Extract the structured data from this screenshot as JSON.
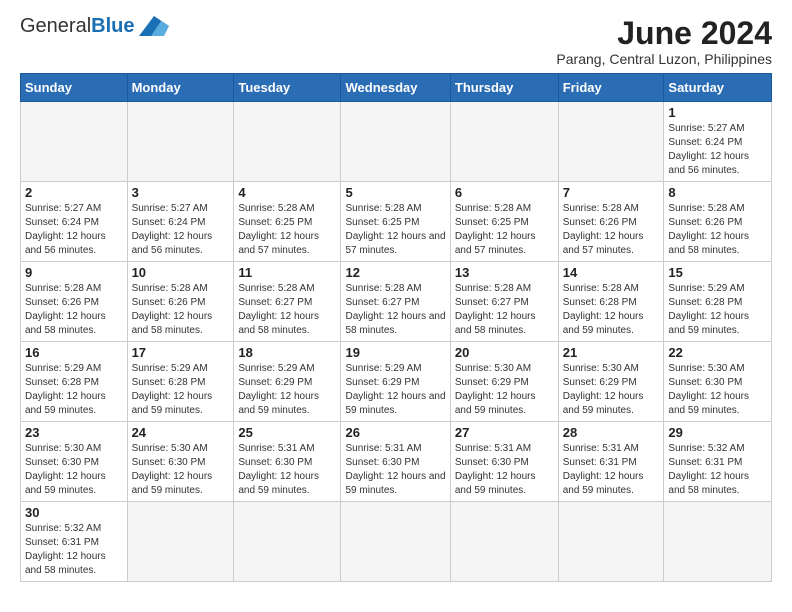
{
  "logo": {
    "general": "General",
    "blue": "Blue"
  },
  "title": "June 2024",
  "subtitle": "Parang, Central Luzon, Philippines",
  "days_of_week": [
    "Sunday",
    "Monday",
    "Tuesday",
    "Wednesday",
    "Thursday",
    "Friday",
    "Saturday"
  ],
  "weeks": [
    [
      {
        "day": "",
        "info": ""
      },
      {
        "day": "",
        "info": ""
      },
      {
        "day": "",
        "info": ""
      },
      {
        "day": "",
        "info": ""
      },
      {
        "day": "",
        "info": ""
      },
      {
        "day": "",
        "info": ""
      },
      {
        "day": "1",
        "info": "Sunrise: 5:27 AM\nSunset: 6:24 PM\nDaylight: 12 hours and 56 minutes."
      }
    ],
    [
      {
        "day": "2",
        "info": "Sunrise: 5:27 AM\nSunset: 6:24 PM\nDaylight: 12 hours and 56 minutes."
      },
      {
        "day": "3",
        "info": "Sunrise: 5:27 AM\nSunset: 6:24 PM\nDaylight: 12 hours and 56 minutes."
      },
      {
        "day": "4",
        "info": "Sunrise: 5:28 AM\nSunset: 6:25 PM\nDaylight: 12 hours and 57 minutes."
      },
      {
        "day": "5",
        "info": "Sunrise: 5:28 AM\nSunset: 6:25 PM\nDaylight: 12 hours and 57 minutes."
      },
      {
        "day": "6",
        "info": "Sunrise: 5:28 AM\nSunset: 6:25 PM\nDaylight: 12 hours and 57 minutes."
      },
      {
        "day": "7",
        "info": "Sunrise: 5:28 AM\nSunset: 6:26 PM\nDaylight: 12 hours and 57 minutes."
      },
      {
        "day": "8",
        "info": "Sunrise: 5:28 AM\nSunset: 6:26 PM\nDaylight: 12 hours and 58 minutes."
      }
    ],
    [
      {
        "day": "9",
        "info": "Sunrise: 5:28 AM\nSunset: 6:26 PM\nDaylight: 12 hours and 58 minutes."
      },
      {
        "day": "10",
        "info": "Sunrise: 5:28 AM\nSunset: 6:26 PM\nDaylight: 12 hours and 58 minutes."
      },
      {
        "day": "11",
        "info": "Sunrise: 5:28 AM\nSunset: 6:27 PM\nDaylight: 12 hours and 58 minutes."
      },
      {
        "day": "12",
        "info": "Sunrise: 5:28 AM\nSunset: 6:27 PM\nDaylight: 12 hours and 58 minutes."
      },
      {
        "day": "13",
        "info": "Sunrise: 5:28 AM\nSunset: 6:27 PM\nDaylight: 12 hours and 58 minutes."
      },
      {
        "day": "14",
        "info": "Sunrise: 5:28 AM\nSunset: 6:28 PM\nDaylight: 12 hours and 59 minutes."
      },
      {
        "day": "15",
        "info": "Sunrise: 5:29 AM\nSunset: 6:28 PM\nDaylight: 12 hours and 59 minutes."
      }
    ],
    [
      {
        "day": "16",
        "info": "Sunrise: 5:29 AM\nSunset: 6:28 PM\nDaylight: 12 hours and 59 minutes."
      },
      {
        "day": "17",
        "info": "Sunrise: 5:29 AM\nSunset: 6:28 PM\nDaylight: 12 hours and 59 minutes."
      },
      {
        "day": "18",
        "info": "Sunrise: 5:29 AM\nSunset: 6:29 PM\nDaylight: 12 hours and 59 minutes."
      },
      {
        "day": "19",
        "info": "Sunrise: 5:29 AM\nSunset: 6:29 PM\nDaylight: 12 hours and 59 minutes."
      },
      {
        "day": "20",
        "info": "Sunrise: 5:30 AM\nSunset: 6:29 PM\nDaylight: 12 hours and 59 minutes."
      },
      {
        "day": "21",
        "info": "Sunrise: 5:30 AM\nSunset: 6:29 PM\nDaylight: 12 hours and 59 minutes."
      },
      {
        "day": "22",
        "info": "Sunrise: 5:30 AM\nSunset: 6:30 PM\nDaylight: 12 hours and 59 minutes."
      }
    ],
    [
      {
        "day": "23",
        "info": "Sunrise: 5:30 AM\nSunset: 6:30 PM\nDaylight: 12 hours and 59 minutes."
      },
      {
        "day": "24",
        "info": "Sunrise: 5:30 AM\nSunset: 6:30 PM\nDaylight: 12 hours and 59 minutes."
      },
      {
        "day": "25",
        "info": "Sunrise: 5:31 AM\nSunset: 6:30 PM\nDaylight: 12 hours and 59 minutes."
      },
      {
        "day": "26",
        "info": "Sunrise: 5:31 AM\nSunset: 6:30 PM\nDaylight: 12 hours and 59 minutes."
      },
      {
        "day": "27",
        "info": "Sunrise: 5:31 AM\nSunset: 6:30 PM\nDaylight: 12 hours and 59 minutes."
      },
      {
        "day": "28",
        "info": "Sunrise: 5:31 AM\nSunset: 6:31 PM\nDaylight: 12 hours and 59 minutes."
      },
      {
        "day": "29",
        "info": "Sunrise: 5:32 AM\nSunset: 6:31 PM\nDaylight: 12 hours and 58 minutes."
      }
    ],
    [
      {
        "day": "30",
        "info": "Sunrise: 5:32 AM\nSunset: 6:31 PM\nDaylight: 12 hours and 58 minutes."
      },
      {
        "day": "",
        "info": ""
      },
      {
        "day": "",
        "info": ""
      },
      {
        "day": "",
        "info": ""
      },
      {
        "day": "",
        "info": ""
      },
      {
        "day": "",
        "info": ""
      },
      {
        "day": "",
        "info": ""
      }
    ]
  ]
}
